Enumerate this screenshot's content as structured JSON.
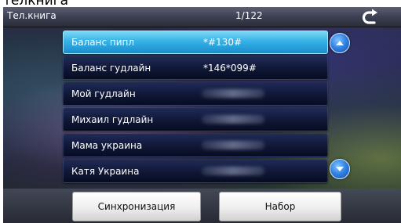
{
  "caption": "телкнига",
  "header": {
    "title": "Тел.книга",
    "page_indicator": "1/122",
    "back_icon": "return-arrow-icon"
  },
  "contacts": [
    {
      "name": "Баланс пипл",
      "number": "*#130#",
      "selected": true
    },
    {
      "name": "Баланс гудлайн",
      "number": "*146*099#",
      "selected": false
    },
    {
      "name": "Мой гудлайн",
      "number": "",
      "selected": false
    },
    {
      "name": "Михаил гудлайн",
      "number": "",
      "selected": false
    },
    {
      "name": "Мама украина",
      "number": "",
      "selected": false
    },
    {
      "name": "Катя Украина",
      "number": "",
      "selected": false
    }
  ],
  "scroll": {
    "up_icon": "chevron-up-icon",
    "down_icon": "chevron-down-icon"
  },
  "buttons": {
    "sync_label": "Синхронизация",
    "dial_label": "Набор"
  },
  "colors": {
    "selected_row": "#36b2e6",
    "row": "#0f1735",
    "scroll_button": "#2f7fe0"
  }
}
